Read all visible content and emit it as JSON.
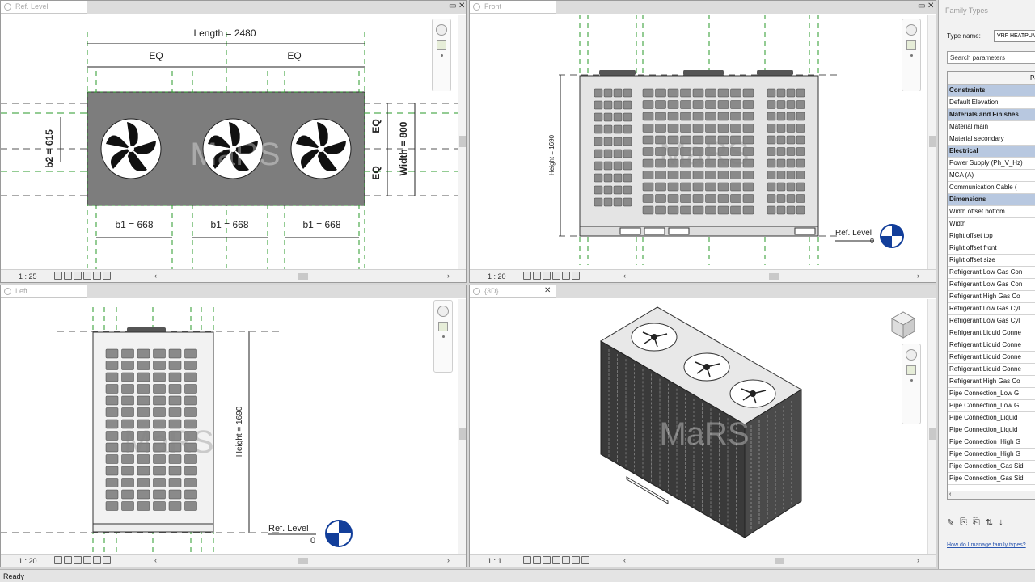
{
  "views": {
    "plan": {
      "tab": "Ref. Level",
      "scale": "1 : 25"
    },
    "front": {
      "tab": "Front",
      "scale": "1 : 20"
    },
    "left": {
      "tab": "Left",
      "scale": "1 : 20"
    },
    "view3d": {
      "tab": "{3D}",
      "scale": "1 : 1"
    }
  },
  "dims": {
    "length": "Length = 2480",
    "eq": "EQ",
    "b1": "b1 = 668",
    "b2": "b2 = 615",
    "width": "Width = 800",
    "height": "Height = 1690",
    "ref_level": "Ref. Level",
    "ref_value": "0"
  },
  "watermark": "MaRS",
  "panel": {
    "title": "Family Types",
    "type_name_label": "Type name:",
    "type_name_value": "VRF HEATPUMP",
    "search_placeholder": "Search parameters",
    "column_header": "Pa",
    "rows": [
      {
        "text": "Constraints",
        "group": true
      },
      {
        "text": "Default Elevation",
        "group": false
      },
      {
        "text": "Materials and Finishes",
        "group": true
      },
      {
        "text": "Material main",
        "group": false
      },
      {
        "text": "Material secondary",
        "group": false
      },
      {
        "text": "Electrical",
        "group": true
      },
      {
        "text": "Power Supply (Ph_V_Hz)",
        "group": false
      },
      {
        "text": "MCA (A)",
        "group": false
      },
      {
        "text": "Communication Cable (",
        "group": false
      },
      {
        "text": "Dimensions",
        "group": true
      },
      {
        "text": "Width offset bottom",
        "group": false
      },
      {
        "text": "Width",
        "group": false
      },
      {
        "text": "Right offset top",
        "group": false
      },
      {
        "text": "Right offset front",
        "group": false
      },
      {
        "text": "Right offset size",
        "group": false
      },
      {
        "text": "Refrigerant Low Gas Con",
        "group": false
      },
      {
        "text": "Refrigerant Low Gas Con",
        "group": false
      },
      {
        "text": "Refrigerant High Gas Co",
        "group": false
      },
      {
        "text": "Refrigerant Low Gas Cyl",
        "group": false
      },
      {
        "text": "Refrigerant Low Gas Cyl",
        "group": false
      },
      {
        "text": "Refrigerant Liquid Conne",
        "group": false
      },
      {
        "text": "Refrigerant Liquid Conne",
        "group": false
      },
      {
        "text": "Refrigerant Liquid Conne",
        "group": false
      },
      {
        "text": "Refrigerant Liquid Conne",
        "group": false
      },
      {
        "text": "Refrigerant High Gas Co",
        "group": false
      },
      {
        "text": "Pipe Connection_Low G",
        "group": false
      },
      {
        "text": "Pipe Connection_Low G",
        "group": false
      },
      {
        "text": "Pipe Connection_Liquid",
        "group": false
      },
      {
        "text": "Pipe Connection_Liquid",
        "group": false
      },
      {
        "text": "Pipe Connection_High G",
        "group": false
      },
      {
        "text": "Pipe Connection_High G",
        "group": false
      },
      {
        "text": "Pipe Connection_Gas Sid",
        "group": false
      },
      {
        "text": "Pipe Connection_Gas Sid",
        "group": false
      }
    ],
    "help_link": "How do I manage family types?"
  },
  "status": "Ready"
}
